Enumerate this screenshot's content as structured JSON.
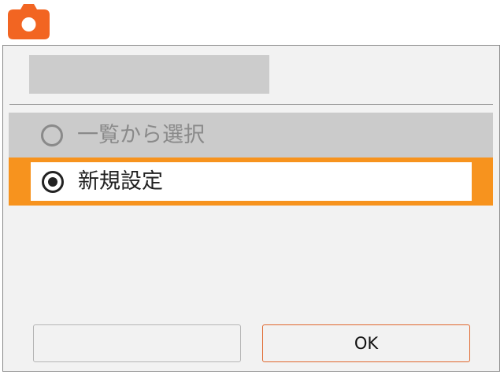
{
  "app": {
    "icon": "camera-icon",
    "icon_color": "#f26522"
  },
  "dialog": {
    "title": "",
    "options": [
      {
        "label": "一覧から選択",
        "selected": false,
        "disabled": true
      },
      {
        "label": "新規設定",
        "selected": true,
        "disabled": false
      }
    ],
    "buttons": {
      "cancel_label": "",
      "ok_label": "OK"
    }
  },
  "colors": {
    "accent": "#f7931e",
    "ok_border": "#e0682e",
    "disabled_row": "#cbcbcb"
  }
}
